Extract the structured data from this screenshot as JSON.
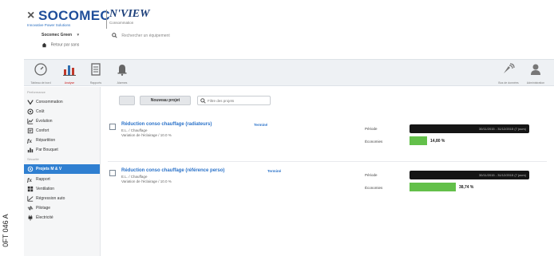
{
  "figure_ref": "0FT 046 A",
  "header": {
    "logo_name": "SOCOMEC",
    "logo_tag": "Innovative Power Solutions",
    "product": "N'VIEW",
    "product_sub": "Consommation",
    "site_selector": "Socomec Green",
    "home_label": "Retour par sans",
    "search_placeholder": "Rechercher un équipement"
  },
  "toolbar": {
    "items": [
      {
        "label": "Tableau de bord",
        "icon": "gauge-icon"
      },
      {
        "label": "Analyse",
        "icon": "bar-chart-icon",
        "active": true
      },
      {
        "label": "Rapports",
        "icon": "document-icon"
      },
      {
        "label": "Alarmes",
        "icon": "bell-icon"
      }
    ],
    "right_items": [
      {
        "label": "Bus de données",
        "icon": "satellite-icon"
      },
      {
        "label": "Administration",
        "icon": "user-admin-icon"
      }
    ]
  },
  "sidebar": {
    "section_1": "Performance",
    "items_1": [
      {
        "label": "Consommation",
        "icon": "flow-icon"
      },
      {
        "label": "Coût",
        "icon": "coin-icon"
      },
      {
        "label": "Évolution",
        "icon": "line-chart-icon"
      },
      {
        "label": "Confort",
        "icon": "thermometer-icon"
      },
      {
        "label": "Répartition",
        "icon": "function-icon"
      },
      {
        "label": "Par Bouquet",
        "icon": "bouquet-icon"
      }
    ],
    "section_2": "Sécurité",
    "items_2": [
      {
        "label": "Projets M & V",
        "icon": "target-icon",
        "active": true
      },
      {
        "label": "Rapport",
        "icon": "function-icon"
      },
      {
        "label": "Ventilation",
        "icon": "grid-icon"
      },
      {
        "label": "Régression auto",
        "icon": "line-chart-icon"
      },
      {
        "label": "Pilotage",
        "icon": "arrows-icon"
      },
      {
        "label": "Électricité",
        "icon": "plug-icon"
      }
    ]
  },
  "main": {
    "new_project_button": "Nouveau projet",
    "search_placeholder": "Filtre des projets",
    "projects": [
      {
        "title": "Réduction conso chauffage (radiateurs)",
        "status": "Terminé",
        "line1": "E.L. / Chauffage",
        "line2": "Variation de l'éclairage / 10.0 %",
        "period_label": "Période",
        "period_text": "30/11/2015 - 31/12/2015 (7 jours)",
        "saving_label": "Économies",
        "saving_pct": 14.8,
        "saving_text": "14,80 %"
      },
      {
        "title": "Réduction conso chauffage (référence perso)",
        "status": "Terminé",
        "line1": "E.L. / Chauffage",
        "line2": "Variation de l'éclairage / 10.0 %",
        "period_label": "Période",
        "period_text": "30/11/2015 - 31/12/2015 (7 jours)",
        "saving_label": "Économies",
        "saving_pct": 38.74,
        "saving_text": "38,74 %"
      }
    ]
  },
  "colors": {
    "brand_blue": "#1f4e9a",
    "link_blue": "#2a72c9",
    "active_blue": "#2f7fd1",
    "saving_green": "#63c04a",
    "period_black": "#151515"
  }
}
